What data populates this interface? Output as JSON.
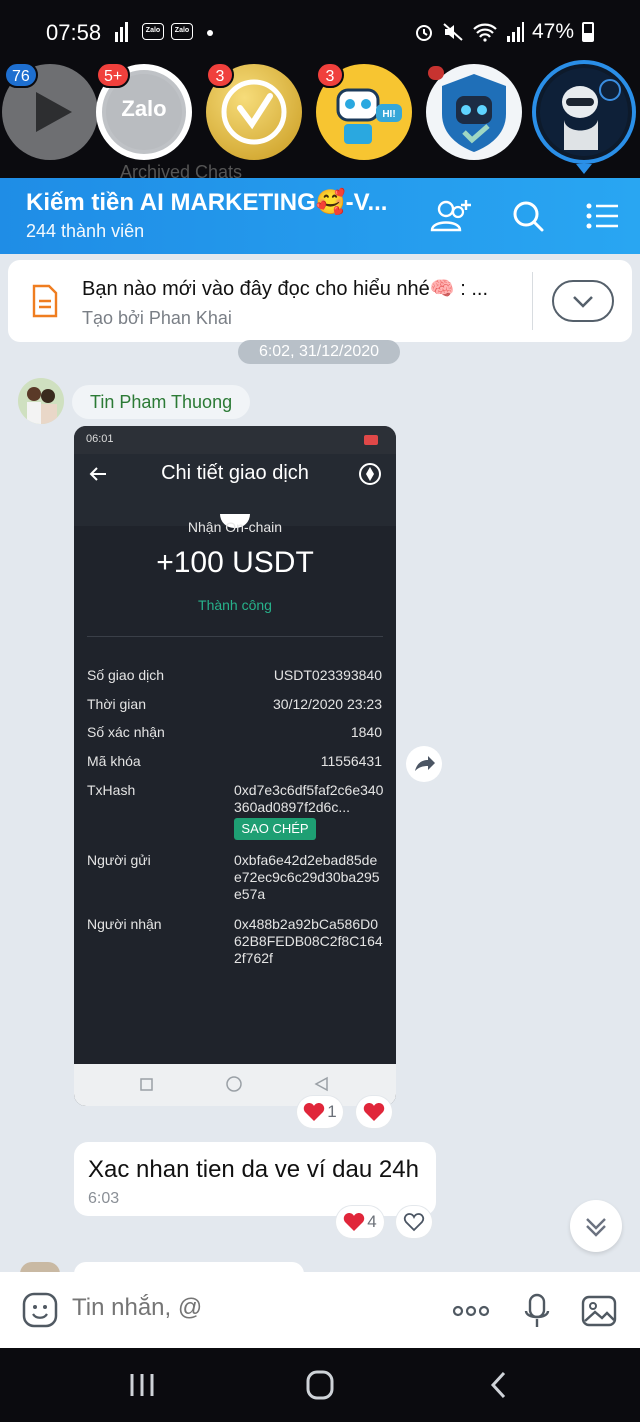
{
  "status_bar": {
    "time": "07:58",
    "app_icon_label": "Zalo",
    "battery": "47%"
  },
  "bubbles": [
    {
      "name": "video-player",
      "badge": "76"
    },
    {
      "name": "zalo",
      "badge": "5+",
      "label": "Zalo"
    },
    {
      "name": "gold-v",
      "badge": "3"
    },
    {
      "name": "robot-hi",
      "badge": "3",
      "label": "HI!"
    },
    {
      "name": "robot-shield",
      "badge": ""
    },
    {
      "name": "robot-ai",
      "badge": ""
    }
  ],
  "archived_text": "Archived Chats",
  "header": {
    "title": "Kiếm tiền AI MARKETING🥰-V...",
    "members": "244 thành viên"
  },
  "pinned": {
    "text": "Bạn nào mới vào đây đọc cho hiểu nhé🧠 : ...",
    "creator": "Tạo bởi Phan Khai"
  },
  "date_divider": "6:02, 31/12/2020",
  "message": {
    "sender": "Tin Pham Thuong"
  },
  "screenshot": {
    "status_time": "06:01",
    "title": "Chi tiết giao dịch",
    "subtitle": "Nhận On-chain",
    "amount": "+100 USDT",
    "status": "Thành công",
    "rows": [
      {
        "label": "Số giao dịch",
        "value": "USDT023393840"
      },
      {
        "label": "Thời gian",
        "value": "30/12/2020 23:23"
      },
      {
        "label": "Số xác nhận",
        "value": "1840"
      },
      {
        "label": "Mã khóa",
        "value": "11556431"
      }
    ],
    "txhash_label": "TxHash",
    "txhash_value": "0xd7e3c6df5faf2c6e340360ad0897f2d6c...",
    "copy_label": "SAO CHÉP",
    "sender_label": "Người gửi",
    "sender_value": "0xbfa6e42d2ebad85dee72ec9c6c29d30ba295e57a",
    "receiver_label": "Người nhận",
    "receiver_value": "0x488b2a92bCa586D062B8FEDB08C2f8C1642f762f"
  },
  "image_reactions": {
    "count": "1"
  },
  "text_message": {
    "body": "Xac nhan tien da ve ví dau 24h",
    "time": "6:03",
    "reaction_count": "4"
  },
  "input": {
    "placeholder": "Tin nhắn, @"
  },
  "colors": {
    "header_start": "#1f8de6",
    "header_end": "#29a6f2",
    "badge": "#f0403c",
    "sender_name": "#2b7a35",
    "success": "#1e9f73",
    "heart": "#e0263a"
  }
}
